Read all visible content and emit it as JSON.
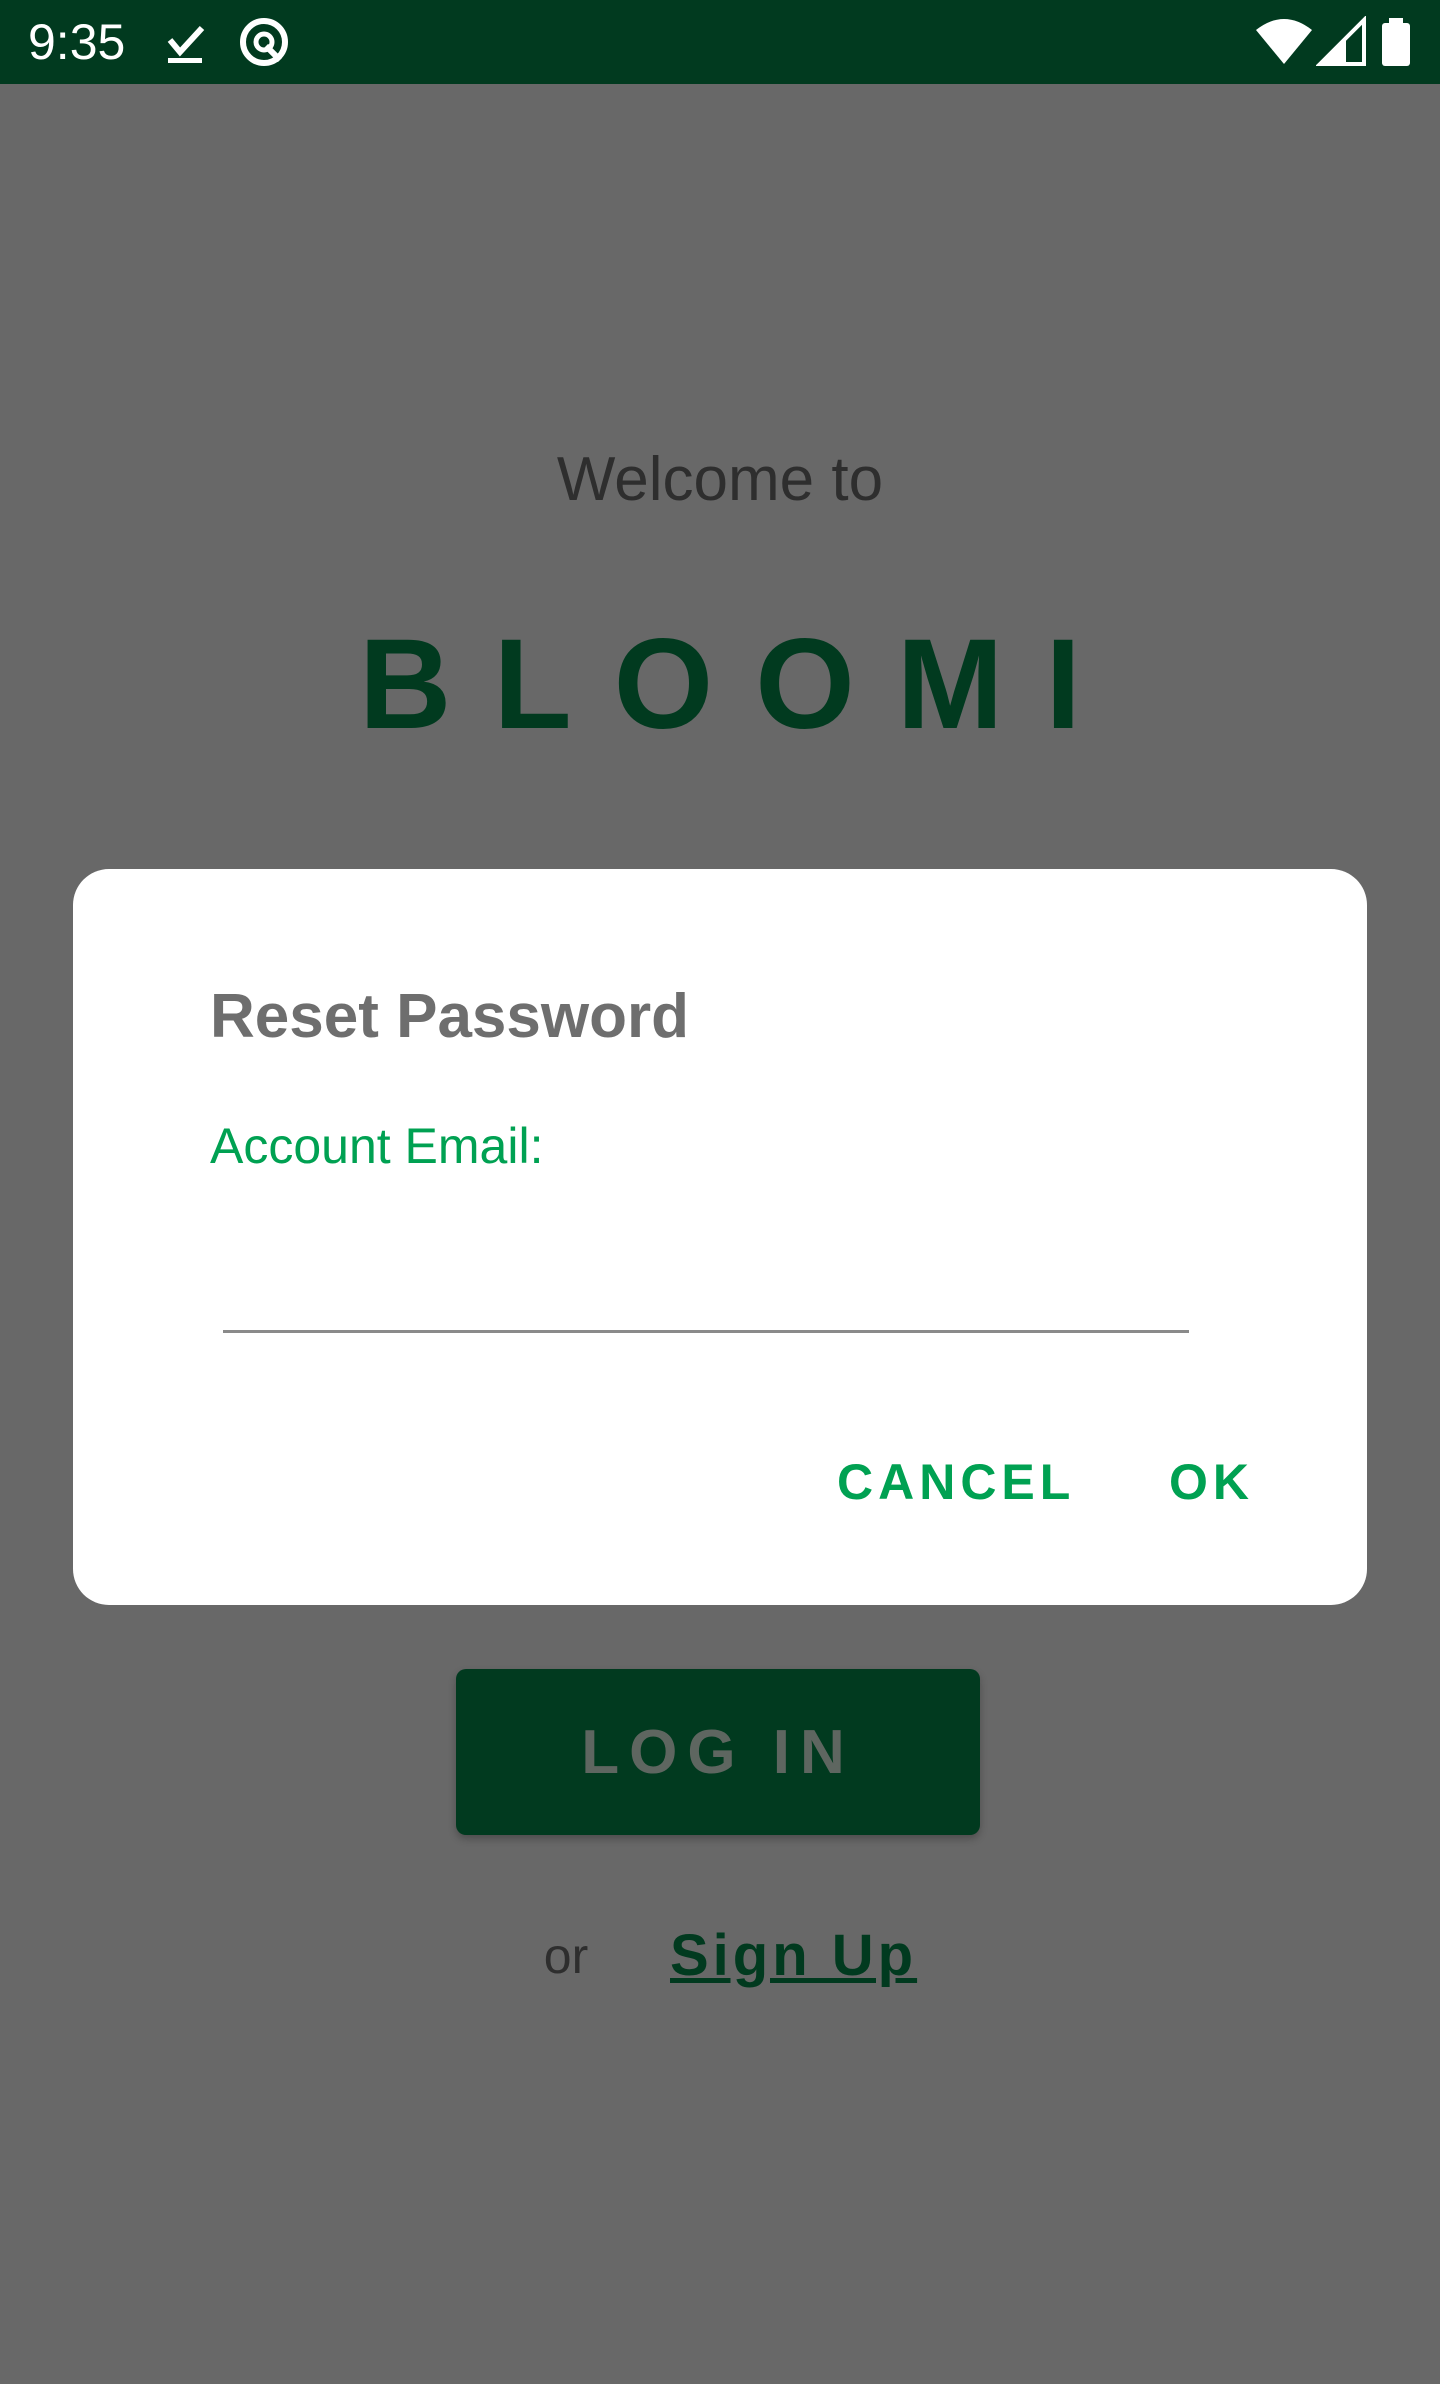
{
  "status_bar": {
    "time": "9:35",
    "icons": [
      "download-done-icon",
      "at-sign-icon",
      "wifi-icon",
      "signal-icon",
      "battery-icon"
    ],
    "background": "#013a1f"
  },
  "screen": {
    "welcome_text": "Welcome to",
    "brand_name": "BLOOMI",
    "login_label": "LOG IN",
    "or_text": "or",
    "signup_label": "Sign Up",
    "brand_color": "#013a1f"
  },
  "dialog": {
    "title": "Reset Password",
    "field_label": "Account Email:",
    "email_value": "",
    "cancel_label": "CANCEL",
    "ok_label": "OK",
    "accent_color": "#00a152"
  }
}
